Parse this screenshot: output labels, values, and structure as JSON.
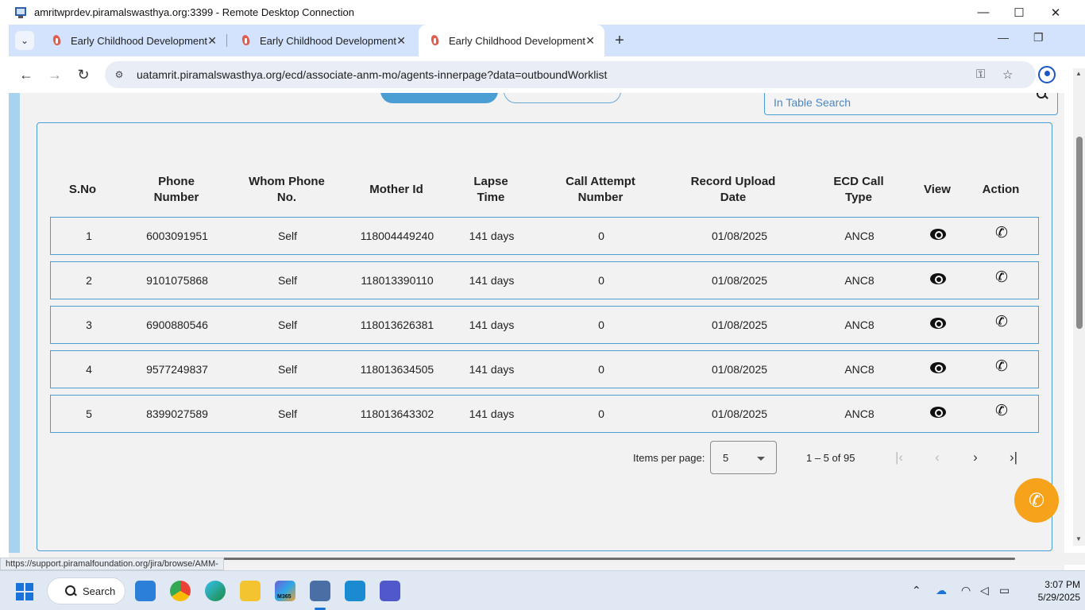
{
  "rdp": {
    "title": "amritwprdev.piramalswasthya.org:3399 - Remote Desktop Connection",
    "minimize": "—",
    "maximize": "☐",
    "close": "✕"
  },
  "tabs": [
    {
      "label": "Early Childhood Development",
      "close": "✕"
    },
    {
      "label": "Early Childhood Development",
      "close": "✕"
    },
    {
      "label": "Early Childhood Development",
      "close": "✕",
      "active": true
    }
  ],
  "browser_controls": {
    "tab_search": "⌄",
    "new_tab": "+",
    "minimize": "—",
    "restore": "❐"
  },
  "toolbar": {
    "back": "←",
    "forward": "→",
    "reload": "↻",
    "url": "uatamrit.piramalswasthya.org/ecd/associate-anm-mo/agents-innerpage?data=outboundWorklist",
    "site_info": "⚙",
    "password": "⚿",
    "bookmark": "☆"
  },
  "search": {
    "placeholder": "In Table Search"
  },
  "table": {
    "headers": [
      "S.No",
      "Phone\nNumber",
      "Whom Phone\nNo.",
      "Mother Id",
      "Lapse\nTime",
      "Call Attempt\nNumber",
      "Record Upload\nDate",
      "ECD Call\nType",
      "View",
      "Action"
    ],
    "rows": [
      {
        "sno": "1",
        "phone": "6003091951",
        "whom": "Self",
        "mother_id": "118004449240",
        "lapse": "141 days",
        "attempt": "0",
        "upload_date": "01/08/2025",
        "call_type": "ANC8"
      },
      {
        "sno": "2",
        "phone": "9101075868",
        "whom": "Self",
        "mother_id": "118013390110",
        "lapse": "141 days",
        "attempt": "0",
        "upload_date": "01/08/2025",
        "call_type": "ANC8"
      },
      {
        "sno": "3",
        "phone": "6900880546",
        "whom": "Self",
        "mother_id": "118013626381",
        "lapse": "141 days",
        "attempt": "0",
        "upload_date": "01/08/2025",
        "call_type": "ANC8"
      },
      {
        "sno": "4",
        "phone": "9577249837",
        "whom": "Self",
        "mother_id": "118013634505",
        "lapse": "141 days",
        "attempt": "0",
        "upload_date": "01/08/2025",
        "call_type": "ANC8"
      },
      {
        "sno": "5",
        "phone": "8399027589",
        "whom": "Self",
        "mother_id": "118013643302",
        "lapse": "141 days",
        "attempt": "0",
        "upload_date": "01/08/2025",
        "call_type": "ANC8"
      }
    ]
  },
  "paginator": {
    "label": "Items per page:",
    "page_size": "5",
    "range": "1 – 5 of 95",
    "first": "|‹",
    "prev": "‹",
    "next": "›",
    "last": "›|"
  },
  "status_url": "https://support.piramalfoundation.org/jira/browse/AMM-",
  "taskbar": {
    "search_label": "Search",
    "time": "3:07 PM",
    "date": "5/29/2025",
    "m365_label": "M365"
  },
  "icons": {
    "view": "eye-icon",
    "action": "phone-icon",
    "fab": "phone-icon"
  },
  "colors": {
    "accent": "#4a9ed3",
    "fab": "#f7a21b",
    "tab_strip": "#d3e3fd"
  }
}
